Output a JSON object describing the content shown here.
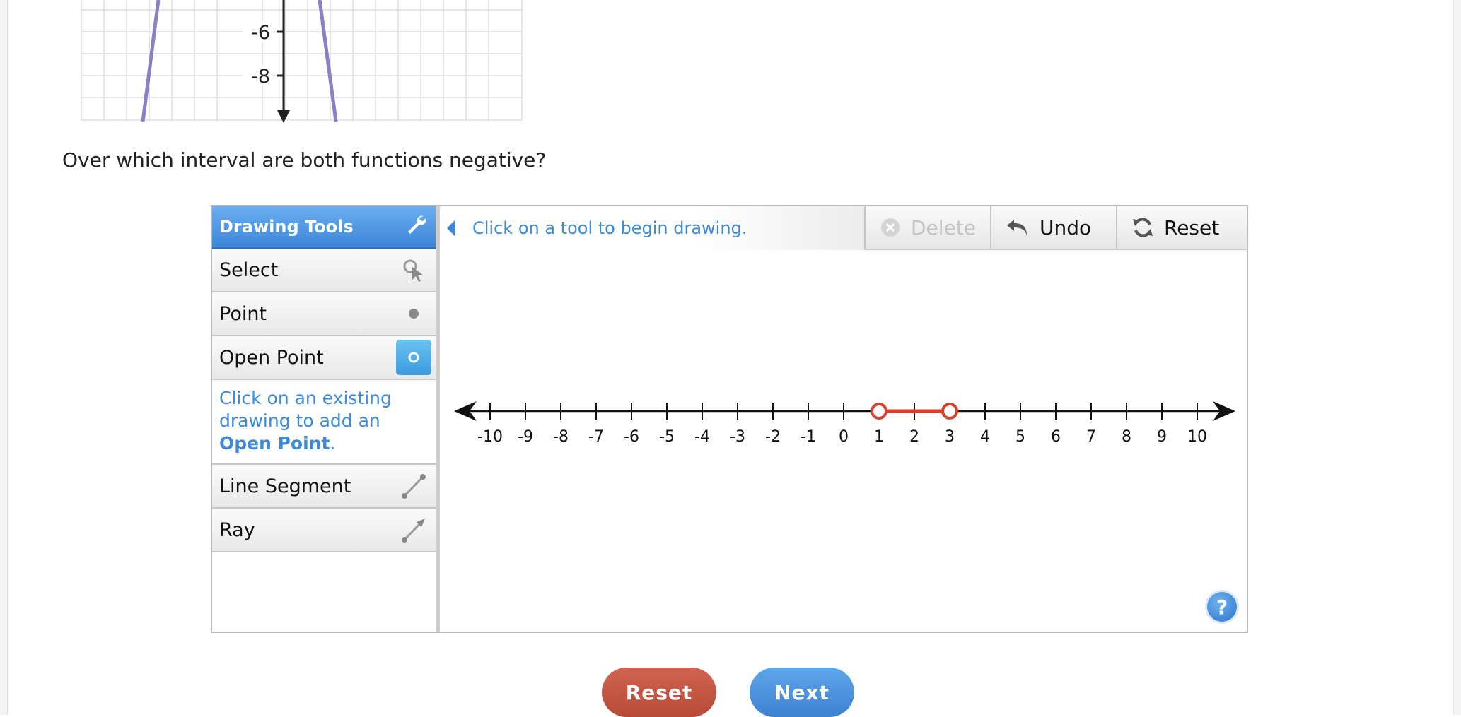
{
  "graph_fragment": {
    "tick_labels": [
      "-6",
      "-8"
    ]
  },
  "question": "Over which interval are both functions negative?",
  "tools": {
    "header": "Drawing Tools",
    "items": [
      {
        "label": "Select",
        "icon": "select-arrow-icon"
      },
      {
        "label": "Point",
        "icon": "point-icon"
      },
      {
        "label": "Open Point",
        "icon": "open-point-icon",
        "active": true
      },
      {
        "label": "Line Segment",
        "icon": "line-segment-icon"
      },
      {
        "label": "Ray",
        "icon": "ray-icon"
      }
    ],
    "help_prefix": "Click on an existing drawing to add an ",
    "help_bold": "Open Point",
    "help_suffix": "."
  },
  "toolbar": {
    "message": "Click on a tool to begin drawing.",
    "delete_label": "Delete",
    "undo_label": "Undo",
    "reset_label": "Reset"
  },
  "number_line": {
    "min": -10,
    "max": 10,
    "tick_labels": [
      "-10",
      "-9",
      "-8",
      "-7",
      "-6",
      "-5",
      "-4",
      "-3",
      "-2",
      "-1",
      "0",
      "1",
      "2",
      "3",
      "4",
      "5",
      "6",
      "7",
      "8",
      "9",
      "10"
    ],
    "segment": {
      "from": 1,
      "to": 3,
      "from_open": true,
      "to_open": true,
      "color": "#d9412f"
    }
  },
  "help_button": "?",
  "nav": {
    "reset_label": "Reset",
    "next_label": "Next"
  },
  "colors": {
    "accent": "#3d86d9",
    "curve": "#8b7fc6",
    "reset": "#c4543f",
    "next": "#4a90dd"
  }
}
